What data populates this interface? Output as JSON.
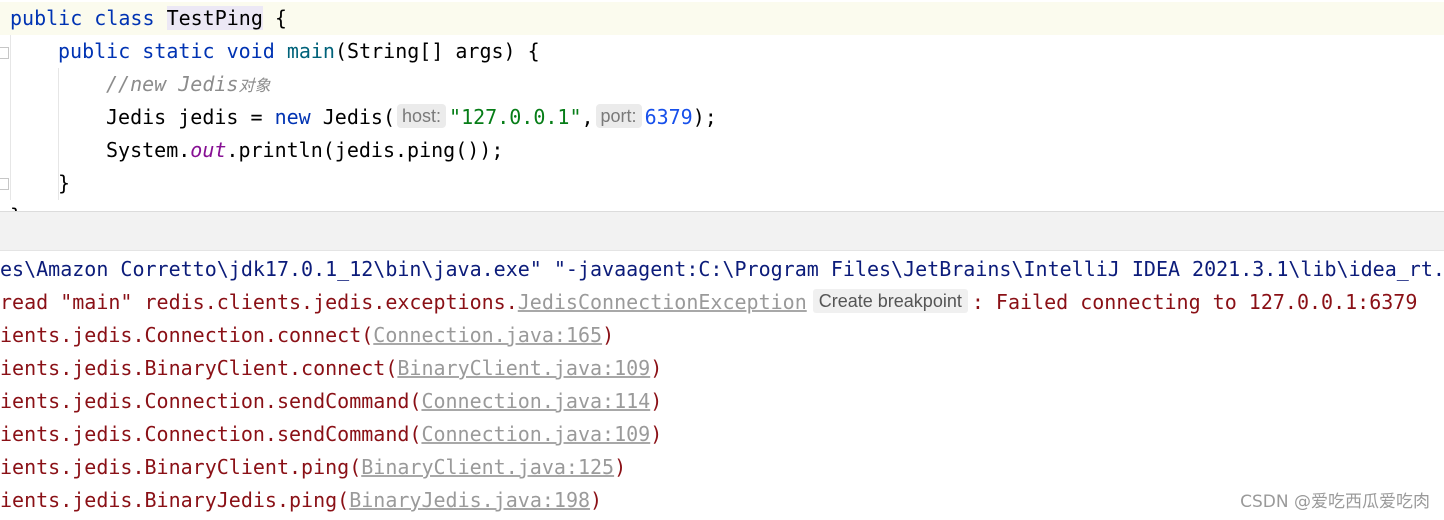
{
  "editor": {
    "line1": {
      "kw1": "public",
      "kw2": "class",
      "class_name": "TestPing",
      "brace": " {"
    },
    "line2": {
      "kw1": "public",
      "kw2": "static",
      "kw3": "void",
      "method": "main",
      "rest": "(String[] args) {"
    },
    "line3": {
      "comment": "//new Jedis",
      "comment_cjk": "对象"
    },
    "line4": {
      "decl": "Jedis jedis = ",
      "kw": "new",
      "ctor": " Jedis(",
      "hint_host": "host:",
      "host_value": "\"127.0.0.1\"",
      "comma": ",",
      "hint_port": "port:",
      "port_value": "6379",
      "end": ");"
    },
    "line5": {
      "obj": "System.",
      "field": "out",
      "rest": ".println(jedis.ping());"
    },
    "line6": {
      "brace": "}"
    },
    "line7": {
      "brace": "}"
    }
  },
  "console": {
    "line1": "es\\Amazon Corretto\\jdk17.0.1_12\\bin\\java.exe\" \"-javaagent:C:\\Program Files\\JetBrains\\IntelliJ IDEA 2021.3.1\\lib\\idea_rt.jar",
    "line2": {
      "prefix": "read \"main\" redis.clients.jedis.exceptions.",
      "exception_link": "JedisConnectionException",
      "breakpoint_label": "Create breakpoint",
      "message": ": Failed connecting to 127.0.0.1:6379"
    },
    "stack": [
      {
        "method": "ients.jedis.Connection.connect(",
        "link": "Connection.java:165",
        "end": ")"
      },
      {
        "method": "ients.jedis.BinaryClient.connect(",
        "link": "BinaryClient.java:109",
        "end": ")"
      },
      {
        "method": "ients.jedis.Connection.sendCommand(",
        "link": "Connection.java:114",
        "end": ")"
      },
      {
        "method": "ients.jedis.Connection.sendCommand(",
        "link": "Connection.java:109",
        "end": ")"
      },
      {
        "method": "ients.jedis.BinaryClient.ping(",
        "link": "BinaryClient.java:125",
        "end": ")"
      },
      {
        "method": "ients.jedis.BinaryJedis.ping(",
        "link": "BinaryJedis.java:198",
        "end": ")"
      }
    ]
  },
  "watermark": "CSDN @爱吃西瓜爱吃肉",
  "colors": {
    "keyword": "#0033b3",
    "string": "#067d17",
    "number": "#1750eb",
    "comment": "#8c8c8c",
    "field": "#871094",
    "error_text": "#8a1016",
    "console_path": "#0c1c7a"
  }
}
